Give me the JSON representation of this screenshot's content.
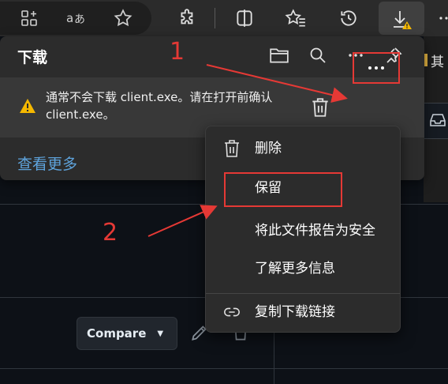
{
  "toolbar": {
    "icons": [
      "extensions-add-icon",
      "read-aloud-icon",
      "favorite-star-icon",
      "extension-puzzle-icon",
      "split-screen-icon",
      "favorites-icon",
      "history-icon",
      "download-warning-icon"
    ],
    "bookmark_partial": "其"
  },
  "downloads": {
    "title": "下载",
    "item_text": "通常不会下载 client.exe。请在打开前确认 client.exe。",
    "see_more": "查看更多"
  },
  "menu": {
    "items": [
      {
        "label": "删除",
        "icon": "trash-icon"
      },
      {
        "label": "保留",
        "icon": ""
      },
      {
        "label": "将此文件报告为安全",
        "icon": ""
      },
      {
        "label": "了解更多信息",
        "icon": ""
      },
      {
        "label": "复制下载链接",
        "icon": "link-icon"
      }
    ]
  },
  "background": {
    "compare_label": "Compare"
  },
  "annotations": {
    "step1": "1",
    "step2": "2"
  },
  "colors": {
    "annotation_red": "#e53935",
    "link_blue": "#5ea3dc",
    "warning_yellow": "#f5b800"
  }
}
